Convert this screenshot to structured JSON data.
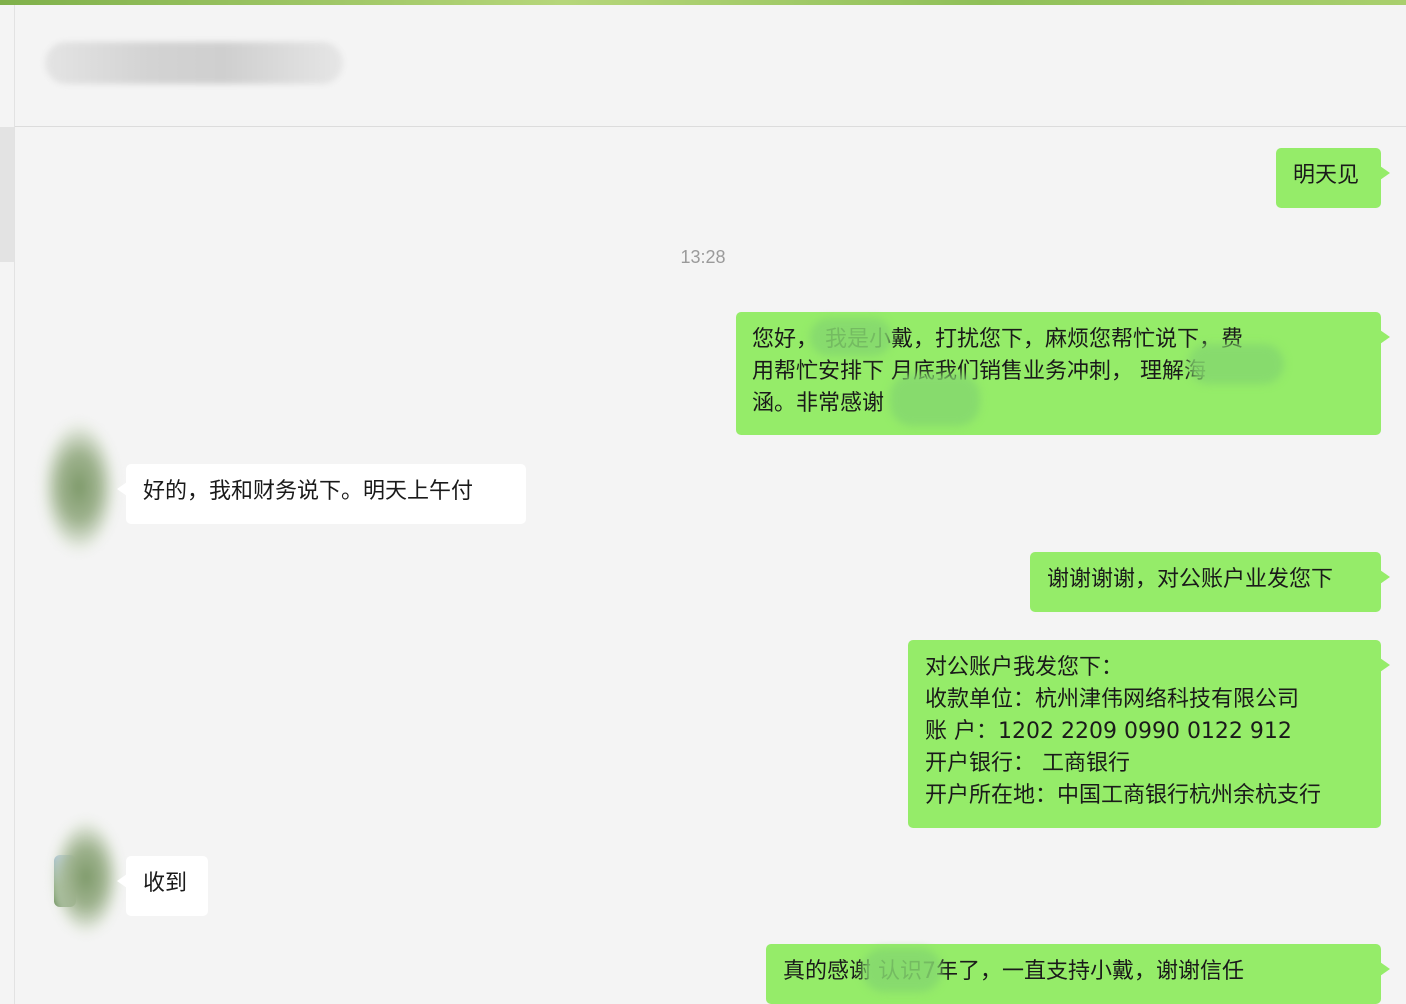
{
  "timestamp": "13:28",
  "messages": [
    {
      "sender": "me",
      "text": "明天见"
    },
    {
      "sender": "me",
      "text": "您好，       我是小戴，打扰您下，麻烦您帮忙说下，费\n用帮忙安排下  月底我们销售业务冲刺，          理解海\n涵。非常感谢"
    },
    {
      "sender": "other",
      "text": "好的，我和财务说下。明天上午付"
    },
    {
      "sender": "me",
      "text": "谢谢谢谢，对公账户业发您下"
    },
    {
      "sender": "me",
      "text": "对公账户我发您下：\n收款单位：杭州津伟网络科技有限公司\n账 户：1202 2209 0990 0122 912\n开户银行：  工商银行\n开户所在地：中国工商银行杭州余杭支行"
    },
    {
      "sender": "other",
      "text": "收到"
    },
    {
      "sender": "me",
      "text": "真的感谢         认识7年了，一直支持小戴，谢谢信任"
    }
  ],
  "colors": {
    "outgoing_bubble": "#95ec69",
    "incoming_bubble": "#ffffff",
    "background": "#f4f4f4"
  }
}
